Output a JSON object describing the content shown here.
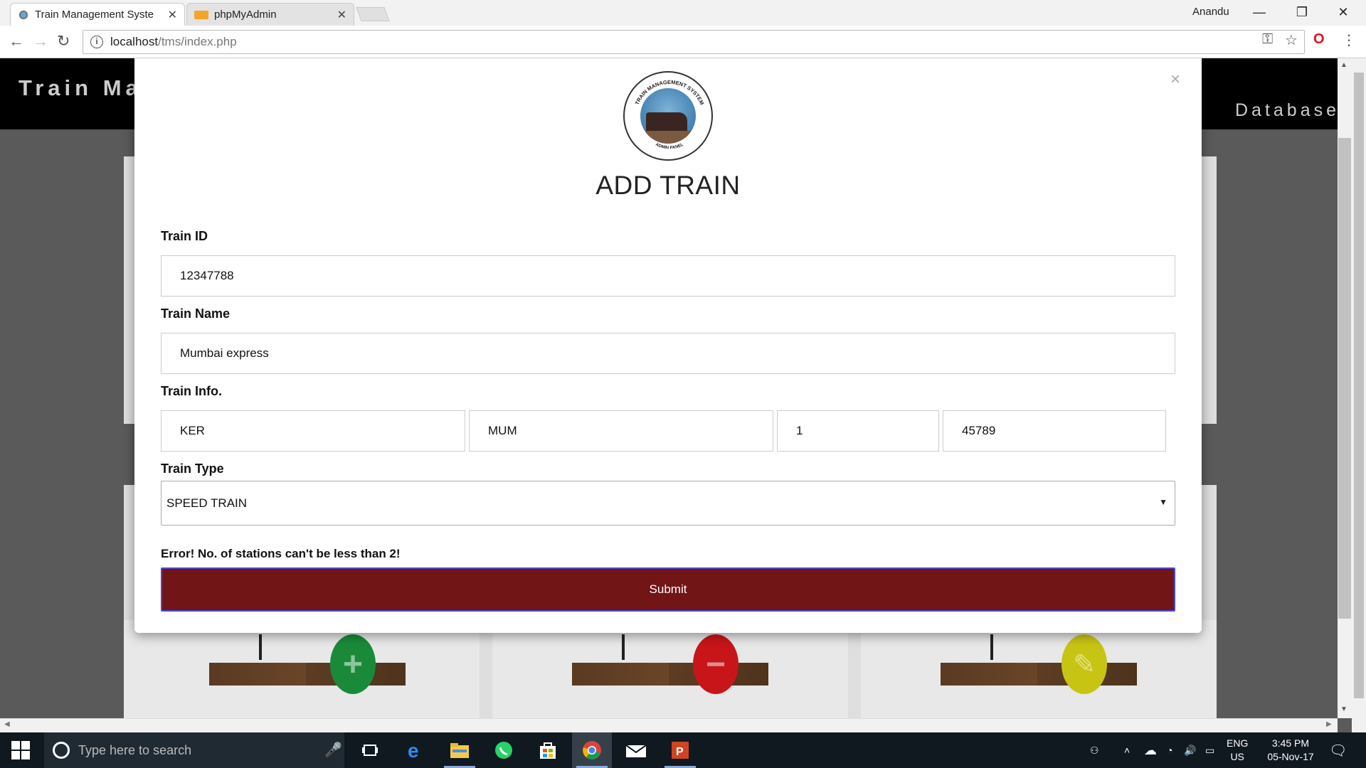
{
  "browser": {
    "tabs": [
      {
        "title": "Train Management Syste",
        "active": true
      },
      {
        "title": "phpMyAdmin",
        "active": false
      }
    ],
    "user": "Anandu",
    "window_controls": {
      "minimize": "—",
      "restore": "❐",
      "close": "✕"
    },
    "url_host": "localhost",
    "url_path": "/tms/index.php"
  },
  "page": {
    "brand": "Train Ma",
    "nav_database": "Database",
    "stations": [
      {
        "name": "add",
        "symbol": "+",
        "color": "#1a8a3a"
      },
      {
        "name": "remove",
        "symbol": "−",
        "color": "#c8151a"
      },
      {
        "name": "edit",
        "symbol": "✎",
        "color": "#c8c414"
      }
    ]
  },
  "modal": {
    "close_label": "×",
    "logo_text_top": "TRAIN MANAGEMENT SYSTEM",
    "logo_text_bottom": "ADMIN PANEL",
    "title": "ADD TRAIN",
    "fields": {
      "train_id_label": "Train ID",
      "train_id_value": "12347788",
      "train_name_label": "Train Name",
      "train_name_value": "Mumbai express",
      "train_info_label": "Train Info.",
      "info_values": [
        "KER",
        "MUM",
        "1",
        "45789"
      ],
      "train_type_label": "Train Type",
      "train_type_value": "SPEED TRAIN"
    },
    "error": "Error! No. of stations can't be less than 2!",
    "submit_label": "Submit"
  },
  "taskbar": {
    "search_placeholder": "Type here to search",
    "lang_1": "ENG",
    "lang_2": "US",
    "time": "3:45 PM",
    "date": "05-Nov-17"
  }
}
